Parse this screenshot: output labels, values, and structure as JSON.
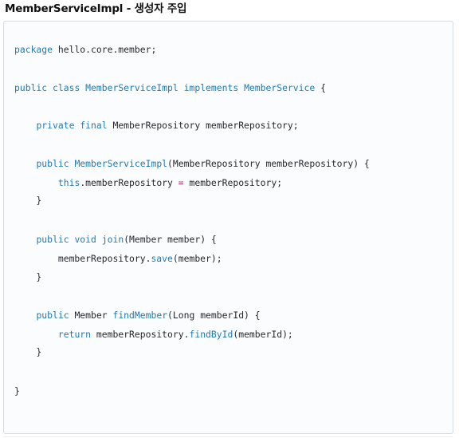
{
  "heading": {
    "title": "MemberServiceImpl",
    "separator": " - ",
    "subtitle": "생성자 주입"
  },
  "code": {
    "l1": [
      "package",
      " hello.core.member;"
    ],
    "l2": [
      "public",
      " ",
      "class",
      " ",
      "MemberServiceImpl",
      " ",
      "implements",
      " ",
      "MemberService",
      " {"
    ],
    "l3": [
      "    ",
      "private",
      " ",
      "final",
      " MemberRepository memberRepository;"
    ],
    "l4": [
      "    ",
      "public",
      " ",
      "MemberServiceImpl",
      "(MemberRepository memberRepository) {"
    ],
    "l5": [
      "        ",
      "this",
      ".memberRepository ",
      "=",
      " memberRepository;"
    ],
    "l6": "    }",
    "l7": [
      "    ",
      "public",
      " ",
      "void",
      " ",
      "join",
      "(Member member) {"
    ],
    "l8": [
      "        memberRepository.",
      "save",
      "(member);"
    ],
    "l9": "    }",
    "l10": [
      "    ",
      "public",
      " Member ",
      "findMember",
      "(Long memberId) {"
    ],
    "l11": [
      "        ",
      "return",
      " memberRepository.",
      "findById",
      "(memberId);"
    ],
    "l12": "    }",
    "l13": "}"
  }
}
